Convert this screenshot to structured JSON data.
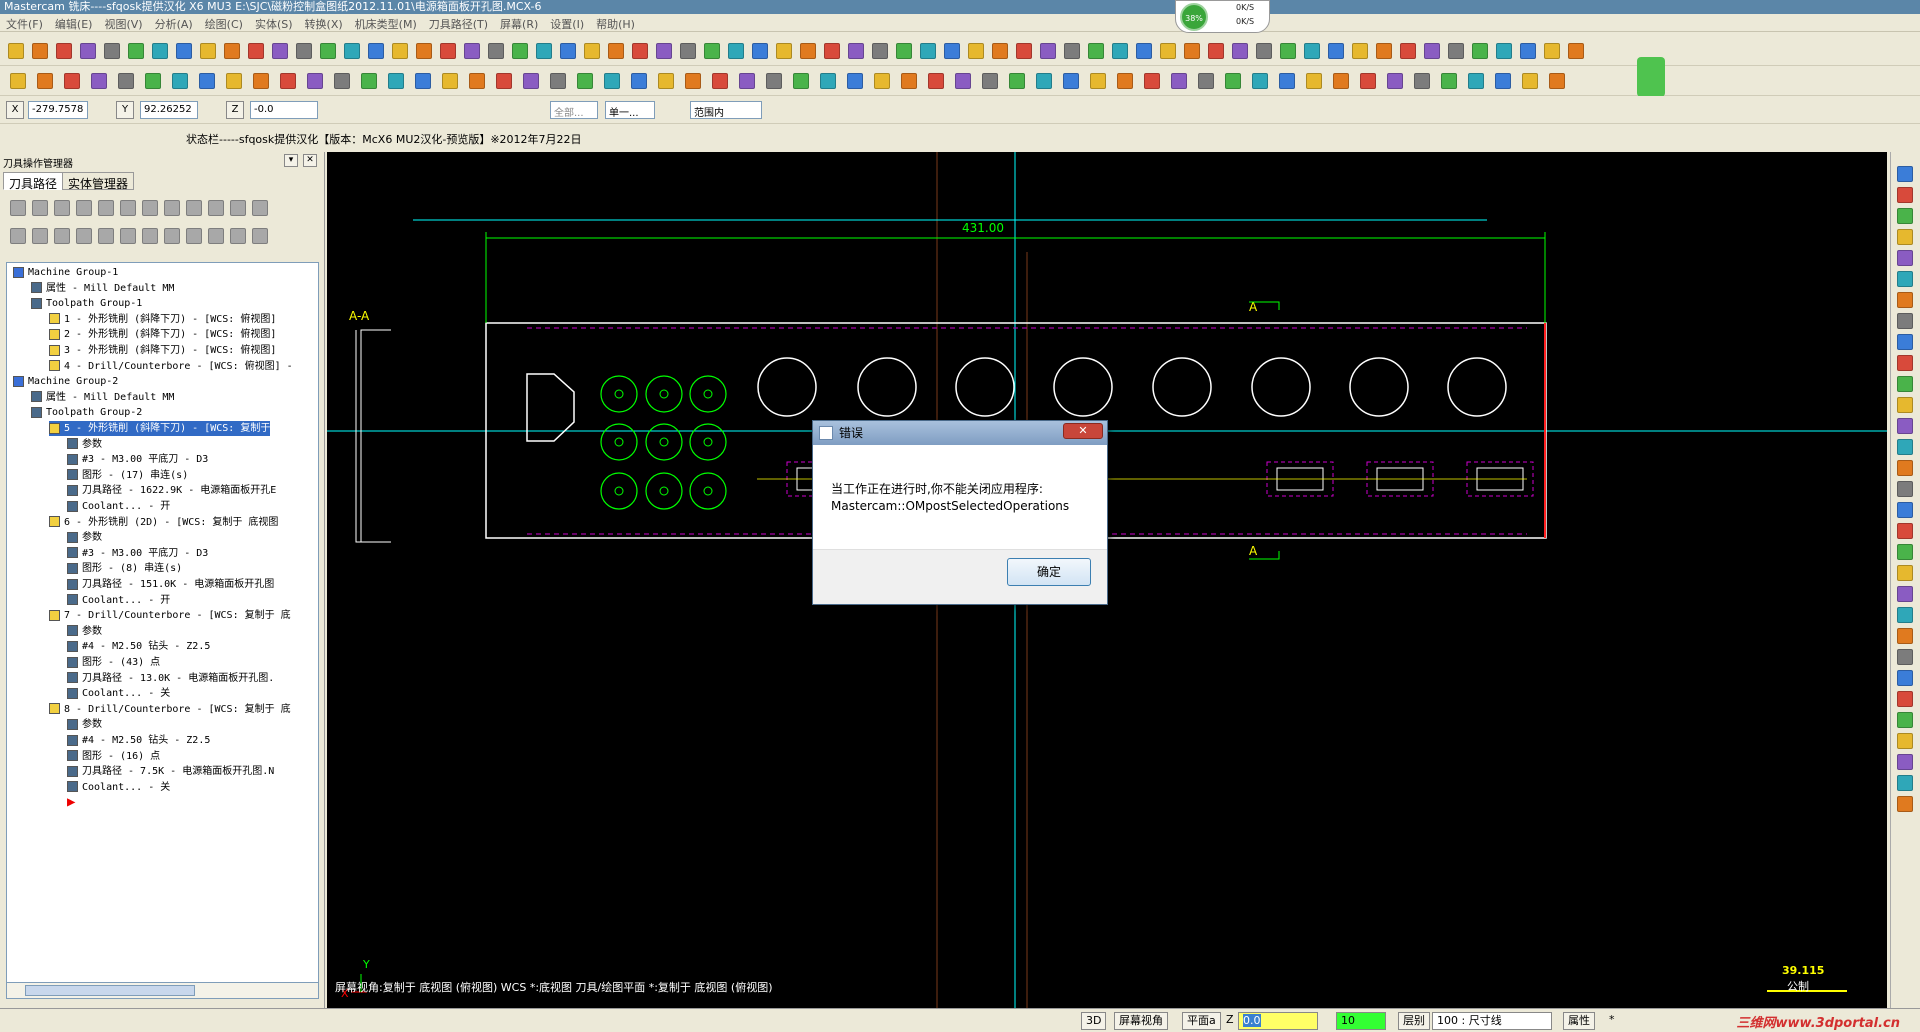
{
  "title": "Mastercam 铣床----sfqosk提供汉化 X6 MU3  E:\\SJC\\磁粉控制盒图纸2012.11.01\\电源箱面板开孔图.MCX-6",
  "menu": [
    "文件(F)",
    "编辑(E)",
    "视图(V)",
    "分析(A)",
    "绘图(C)",
    "实体(S)",
    "转换(X)",
    "机床类型(M)",
    "刀具路径(T)",
    "屏幕(R)",
    "设置(I)",
    "帮助(H)"
  ],
  "perf": {
    "percent": "38%",
    "up": "0K/S",
    "down": "0K/S"
  },
  "coords": {
    "x_label": "X",
    "x_value": "-279.7578",
    "y_label": "Y",
    "y_value": "92.26252",
    "z_label": "Z",
    "z_value": "-0.0"
  },
  "selection": {
    "all": "全部...",
    "single": "单一...",
    "range": "范围内"
  },
  "status_message": "状态栏-----sfqosk提供汉化【版本：McX6 MU2汉化-预览版】※2012年7月22日",
  "panel": {
    "title": "刀具操作管理器",
    "tabs": [
      "刀具路径",
      "实体管理器"
    ],
    "tree": [
      {
        "text": "Machine Group-1",
        "level": 0
      },
      {
        "text": "属性 - Mill Default MM",
        "level": 1
      },
      {
        "text": "Toolpath Group-1",
        "level": 1
      },
      {
        "text": "1 - 外形铣削 (斜降下刀) - [WCS: 俯视图]",
        "level": 2
      },
      {
        "text": "2 - 外形铣削 (斜降下刀) - [WCS: 俯视图]",
        "level": 2
      },
      {
        "text": "3 - 外形铣削 (斜降下刀) - [WCS: 俯视图]",
        "level": 2
      },
      {
        "text": "4 - Drill/Counterbore - [WCS: 俯视图] -",
        "level": 2
      },
      {
        "text": "Machine Group-2",
        "level": 0
      },
      {
        "text": "属性 - Mill Default MM",
        "level": 1
      },
      {
        "text": "Toolpath Group-2",
        "level": 1
      },
      {
        "text": "5 - 外形铣削 (斜降下刀) - [WCS: 复制于",
        "level": 2,
        "selected": true
      },
      {
        "text": "参数",
        "level": 3
      },
      {
        "text": "#3 - M3.00 平底刀 - D3",
        "level": 3
      },
      {
        "text": "图形 - (17) 串连(s)",
        "level": 3
      },
      {
        "text": "刀具路径 - 1622.9K - 电源箱面板开孔Ε",
        "level": 3
      },
      {
        "text": "Coolant... - 开",
        "level": 3
      },
      {
        "text": "6 - 外形铣削 (2D) - [WCS: 复制于 底视图",
        "level": 2
      },
      {
        "text": "参数",
        "level": 3
      },
      {
        "text": "#3 - M3.00 平底刀 - D3",
        "level": 3
      },
      {
        "text": "图形 - (8) 串连(s)",
        "level": 3
      },
      {
        "text": "刀具路径 - 151.0K - 电源箱面板开孔图",
        "level": 3
      },
      {
        "text": "Coolant... - 开",
        "level": 3
      },
      {
        "text": "7 - Drill/Counterbore - [WCS: 复制于 底",
        "level": 2
      },
      {
        "text": "参数",
        "level": 3
      },
      {
        "text": "#4 - M2.50 钻头 - Z2.5",
        "level": 3
      },
      {
        "text": "图形 - (43) 点",
        "level": 3
      },
      {
        "text": "刀具路径 - 13.0K - 电源箱面板开孔图.",
        "level": 3
      },
      {
        "text": "Coolant... - 关",
        "level": 3
      },
      {
        "text": "8 - Drill/Counterbore - [WCS: 复制于 底",
        "level": 2
      },
      {
        "text": "参数",
        "level": 3
      },
      {
        "text": "#4 - M2.50 钻头 - Z2.5",
        "level": 3
      },
      {
        "text": "图形 - (16) 点",
        "level": 3
      },
      {
        "text": "刀具路径 - 7.5K - 电源箱面板开孔图.N",
        "level": 3
      },
      {
        "text": "Coolant... - 关",
        "level": 3
      }
    ]
  },
  "drawing": {
    "dimension": "431.00",
    "section_label": "A-A",
    "cut_label_top": "A",
    "cut_label_bottom": "A",
    "canvas_status": "屏幕视角:复制于 底视图 (俯视图)    WCS *:底视图    刀具/绘图平面 *:复制于 底视图 (俯视图)",
    "scale_value": "39.115",
    "scale_unit": "公制",
    "axis_x": "X",
    "axis_y": "Y"
  },
  "dialog": {
    "title": "错误",
    "close": "✕",
    "line1": "当工作正在进行时,你不能关闭应用程序:",
    "line2": "Mastercam::OMpostSelectedOperations",
    "ok": "确定"
  },
  "bottom": {
    "btn3d": "3D",
    "screen_view": "屏幕视角",
    "plane": "平面a",
    "z_label": "Z",
    "z_value": "0.0",
    "level_value": "10",
    "level_label": "层别",
    "level_name": "100 : 尺寸线",
    "attr": "属性",
    "star": "*"
  },
  "watermark": "三维网www.3dportal.cn"
}
